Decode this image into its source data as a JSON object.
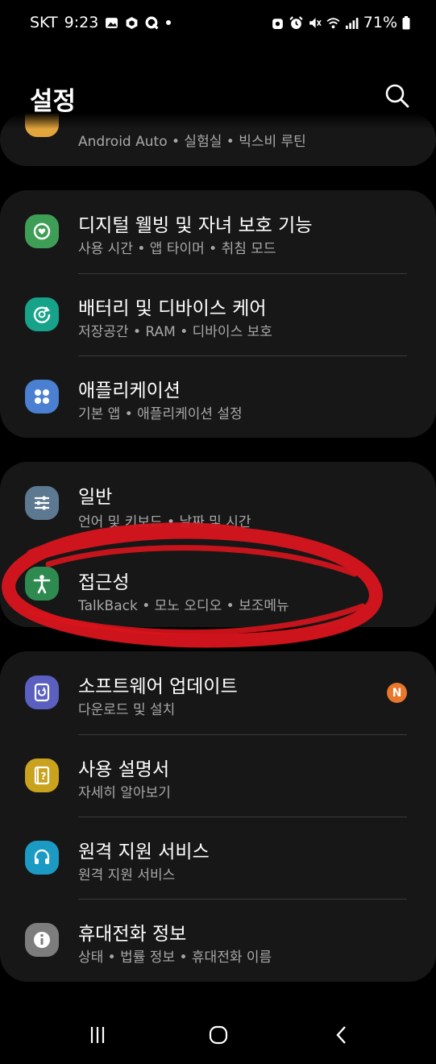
{
  "status_bar": {
    "carrier": "SKT",
    "time": "9:23",
    "battery": "71%"
  },
  "header": {
    "title": "설정"
  },
  "partial_item": {
    "subtitle": "Android Auto • 실험실 • 빅스비 루틴"
  },
  "groups": [
    {
      "items": [
        {
          "title": "디지털 웰빙 및 자녀 보호 기능",
          "subtitle": "사용 시간 • 앱 타이머 • 취침 모드",
          "icon": "digital-wellbeing-icon",
          "color": "#3f9e56"
        },
        {
          "title": "배터리 및 디바이스 케어",
          "subtitle": "저장공간 • RAM • 디바이스 보호",
          "icon": "device-care-icon",
          "color": "#17a38a"
        },
        {
          "title": "애플리케이션",
          "subtitle": "기본 앱 • 애플리케이션 설정",
          "icon": "apps-icon",
          "color": "#4a7fd1"
        }
      ]
    },
    {
      "items": [
        {
          "title": "일반",
          "subtitle": "언어 및 키보드 • 날짜 및 시간",
          "icon": "general-management-icon",
          "color": "#5d7891"
        },
        {
          "title": "접근성",
          "subtitle": "TalkBack • 모노 오디오 • 보조메뉴",
          "icon": "accessibility-icon",
          "color": "#2e8a4f"
        }
      ]
    },
    {
      "items": [
        {
          "title": "소프트웨어 업데이트",
          "subtitle": "다운로드 및 설치",
          "icon": "software-update-icon",
          "color": "#5a5fc0",
          "badge": "N"
        },
        {
          "title": "사용 설명서",
          "subtitle": "자세히 알아보기",
          "icon": "user-manual-icon",
          "color": "#c9a21e"
        },
        {
          "title": "원격 지원 서비스",
          "subtitle": "원격 지원 서비스",
          "icon": "remote-support-icon",
          "color": "#1b9bc4"
        },
        {
          "title": "휴대전화 정보",
          "subtitle": "상태 • 법률 정보 • 휴대전화 이름",
          "icon": "phone-info-icon",
          "color": "#7d7d7d"
        }
      ]
    }
  ],
  "colors": {
    "background": "#000000",
    "card": "#171717",
    "annotation": "#d8141c",
    "badge": "#e8762b"
  }
}
